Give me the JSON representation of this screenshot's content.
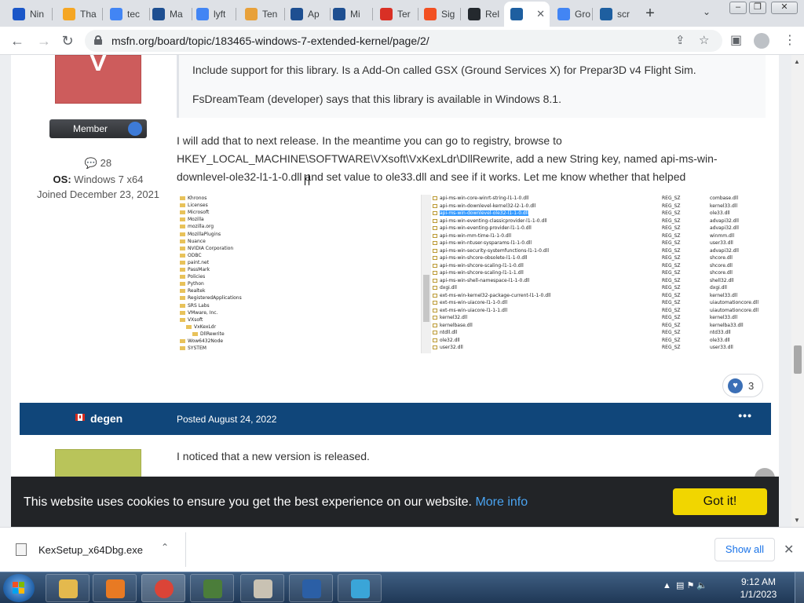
{
  "browser": {
    "tabs": [
      {
        "title": "Nin",
        "icon_color": "#1a56c8",
        "icon": "wolf-icon"
      },
      {
        "title": "Tha",
        "icon_color": "#f5a623",
        "icon": "thumbs-up-icon"
      },
      {
        "title": "tec",
        "icon_color": "#4285f4",
        "icon": "google-icon"
      },
      {
        "title": "Ma",
        "icon_color": "#1e4f91",
        "icon": "msfn-icon"
      },
      {
        "title": "lyft",
        "icon_color": "#4285f4",
        "icon": "google-icon"
      },
      {
        "title": "Ten",
        "icon_color": "#e8a13a",
        "icon": "envelope-icon"
      },
      {
        "title": "Ap",
        "icon_color": "#1e4f91",
        "icon": "msfn-icon"
      },
      {
        "title": "Mi",
        "icon_color": "#1e4f91",
        "icon": "msfn-icon"
      },
      {
        "title": "Ter",
        "icon_color": "#d93025",
        "icon": "mail-icon"
      },
      {
        "title": "Sig",
        "icon_color": "#f25022",
        "icon": "microsoft-icon"
      },
      {
        "title": "Rel",
        "icon_color": "#24292e",
        "icon": "github-icon"
      },
      {
        "title": "",
        "icon_color": "#1e5fa0",
        "icon": "msfn-icon",
        "active": true
      },
      {
        "title": "Gro",
        "icon_color": "#4285f4",
        "icon": "google-icon"
      },
      {
        "title": "scr",
        "icon_color": "#1e5fa0",
        "icon": "msfn-icon"
      }
    ],
    "new_tab": "+",
    "tab_search": "⌄",
    "window_controls": {
      "minimize": "–",
      "restore": "❐",
      "close": "✕"
    },
    "url": "msfn.org/board/topic/183465-windows-7-extended-kernel/page/2/",
    "nav": {
      "back": "←",
      "forward": "→",
      "reload": "↻"
    }
  },
  "post1": {
    "avatar_letter": "V",
    "rank": "Member",
    "post_count": "28",
    "os_label": "OS:",
    "os_value": "Windows 7 x64",
    "joined": "Joined December 23, 2021",
    "quote_line1": "Include support for this library. Is a Add-On called GSX (Ground Services X) for Prepar3D v4 Flight Sim.",
    "quote_line2": "FsDreamTeam (developer) says that this library is available in Windows 8.1.",
    "reply_line1": "I will add that to next release. In the meantime you can go to registry, browse to",
    "reply_line2": "HKEY_LOCAL_MACHINE\\SOFTWARE\\VXsoft\\VxKexLdr\\DllRewrite, add a new String key, named api-ms-win-",
    "reply_line3": "downlevel-ole32-l1-1-0.dll and set value to ole33.dll and see if it works. Let me know whether that helped",
    "likes": "3"
  },
  "registry_tree": [
    "Khronos",
    "Licenses",
    "Microsoft",
    "Mozilla",
    "mozilla.org",
    "MozillaPlugins",
    "Nuance",
    "NVIDIA Corporation",
    "ODBC",
    "paint.net",
    "PassMark",
    "Policies",
    "Python",
    "Realtek",
    "RegisteredApplications",
    "SRS Labs",
    "VMware, Inc.",
    "VXsoft",
    "VxKexLdr",
    "DllRewrite",
    "Wow6432Node",
    "SYSTEM"
  ],
  "registry_rows": [
    {
      "name": "api-ms-win-core-winrt-string-l1-1-0.dll",
      "type": "REG_SZ",
      "data": "combase.dll"
    },
    {
      "name": "api-ms-win-downlevel-kernel32-l2-1-0.dll",
      "type": "REG_SZ",
      "data": "kernel33.dll"
    },
    {
      "name": "api-ms-win-downlevel-ole32-l1-1-0.dll",
      "type": "REG_SZ",
      "data": "ole33.dll",
      "selected": true
    },
    {
      "name": "api-ms-win-eventing-classicprovider-l1-1-0.dll",
      "type": "REG_SZ",
      "data": "advapi32.dll"
    },
    {
      "name": "api-ms-win-eventing-provider-l1-1-0.dll",
      "type": "REG_SZ",
      "data": "advapi32.dll"
    },
    {
      "name": "api-ms-win-mm-time-l1-1-0.dll",
      "type": "REG_SZ",
      "data": "winmm.dll"
    },
    {
      "name": "api-ms-win-ntuser-sysparams-l1-1-0.dll",
      "type": "REG_SZ",
      "data": "user33.dll"
    },
    {
      "name": "api-ms-win-security-systemfunctions-l1-1-0.dll",
      "type": "REG_SZ",
      "data": "advapi32.dll"
    },
    {
      "name": "api-ms-win-shcore-obsolete-l1-1-0.dll",
      "type": "REG_SZ",
      "data": "shcore.dll"
    },
    {
      "name": "api-ms-win-shcore-scaling-l1-1-0.dll",
      "type": "REG_SZ",
      "data": "shcore.dll"
    },
    {
      "name": "api-ms-win-shcore-scaling-l1-1-1.dll",
      "type": "REG_SZ",
      "data": "shcore.dll"
    },
    {
      "name": "api-ms-win-shell-namespace-l1-1-0.dll",
      "type": "REG_SZ",
      "data": "shell32.dll"
    },
    {
      "name": "dxgi.dll",
      "type": "REG_SZ",
      "data": "dxgi.dll"
    },
    {
      "name": "ext-ms-win-kernel32-package-current-l1-1-0.dll",
      "type": "REG_SZ",
      "data": "kernel33.dll"
    },
    {
      "name": "ext-ms-win-uiacore-l1-1-0.dll",
      "type": "REG_SZ",
      "data": "uiautomationcore.dll"
    },
    {
      "name": "ext-ms-win-uiacore-l1-1-1.dll",
      "type": "REG_SZ",
      "data": "uiautomationcore.dll"
    },
    {
      "name": "kernel32.dll",
      "type": "REG_SZ",
      "data": "kernel33.dll"
    },
    {
      "name": "kernelbase.dll",
      "type": "REG_SZ",
      "data": "kernelba33.dll"
    },
    {
      "name": "ntdll.dll",
      "type": "REG_SZ",
      "data": "ntd33.dll"
    },
    {
      "name": "ole32.dll",
      "type": "REG_SZ",
      "data": "ole33.dll"
    },
    {
      "name": "user32.dll",
      "type": "REG_SZ",
      "data": "user33.dll"
    }
  ],
  "post2": {
    "author": "degen",
    "posted": "Posted August 24, 2022",
    "menu": "•••",
    "text": "I noticed that a new version is released."
  },
  "cookie": {
    "text": "This website uses cookies to ensure you get the best experience on our website.",
    "link": "More info",
    "button": "Got it!"
  },
  "downloads": {
    "file": "KexSetup_x64Dbg.exe",
    "show_all": "Show all",
    "close": "✕"
  },
  "taskbar": {
    "time": "9:12 AM",
    "date": "1/1/2023",
    "tray_arrow": "▲",
    "colors": {
      "explorer": "#e4b94d",
      "media": "#e87a23",
      "chrome": "#db4437",
      "terminal": "#4b7d3a",
      "tool": "#c9c2b3",
      "msfn": "#2b5fa6",
      "blocks": "#3aa5d8"
    }
  }
}
